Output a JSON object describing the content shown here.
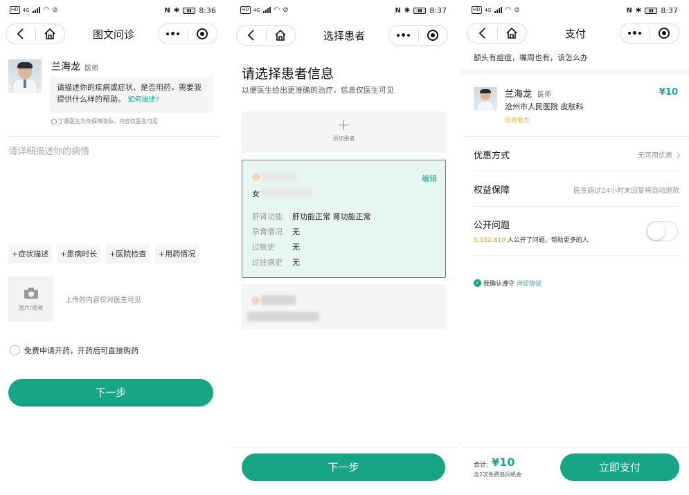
{
  "status": {
    "screen1_time": "8:36",
    "screen2_time": "8:37",
    "screen3_time": "8:37",
    "hd": "HD",
    "network": "4G"
  },
  "screen1": {
    "title": "图文问诊",
    "doctor_name": "兰海龙",
    "doctor_title": "医师",
    "prompt_text": "请描述你的疾病或症状、是否用药，需要我提供什么样的帮助。",
    "prompt_link": "如何描述?",
    "privacy_note": "丁香医生为你保障隐私，内容仅医生可见",
    "textarea_placeholder": "请详细描述你的病情",
    "chips": [
      "症状描述",
      "患病时长",
      "医院检查",
      "用药情况"
    ],
    "upload_label": "图片/视频",
    "upload_note": "上传的内容仅对医生可见",
    "free_prescription": "免费申请开药，开药后可直接购药",
    "next_button": "下一步"
  },
  "screen2": {
    "title": "选择患者",
    "heading": "请选择患者信息",
    "subheading": "以便医生给出更准确的治疗，信息仅医生可见",
    "add_patient": "添加患者",
    "patient_gender": "女",
    "edit": "编辑",
    "rows": [
      {
        "label": "肝肾功能",
        "value": "肝功能正常 肾功能正常"
      },
      {
        "label": "孕育情况",
        "value": "无"
      },
      {
        "label": "过敏史",
        "value": "无"
      },
      {
        "label": "过往病史",
        "value": "无"
      }
    ],
    "next_button": "下一步"
  },
  "screen3": {
    "title": "支付",
    "question_excerpt": "额头有痘痘，嘴周也有，该怎么办",
    "doctor_name": "兰海龙",
    "doctor_title": "医师",
    "hospital": "沧州市人民医院",
    "department": "皮肤科",
    "can_prescribe": "可开处方",
    "price": "¥10",
    "discount_label": "优惠方式",
    "discount_value": "无可用优惠",
    "guarantee_label": "权益保障",
    "guarantee_value": "医生超过24小时未回复将自动退款",
    "public_label": "公开问题",
    "public_count": "5,552,810",
    "public_desc": "人公开了问题，帮助更多的人",
    "agree_text": "我确认遵守",
    "agree_link": "问诊协议",
    "total_label": "合计:",
    "total_value": "¥10",
    "followup_note": "含2次免费追问机会",
    "pay_button": "立即支付"
  },
  "icons": {
    "back": "back-arrow-icon",
    "home": "home-icon",
    "more": "more-dots-icon",
    "target": "target-icon",
    "camera": "camera-icon",
    "plus": "plus-icon",
    "check": "check-circle-icon",
    "shield": "shield-icon"
  },
  "colors": {
    "accent": "#17a685",
    "price_orange": "#f0a020",
    "selected_bg": "#e8f6f3"
  }
}
